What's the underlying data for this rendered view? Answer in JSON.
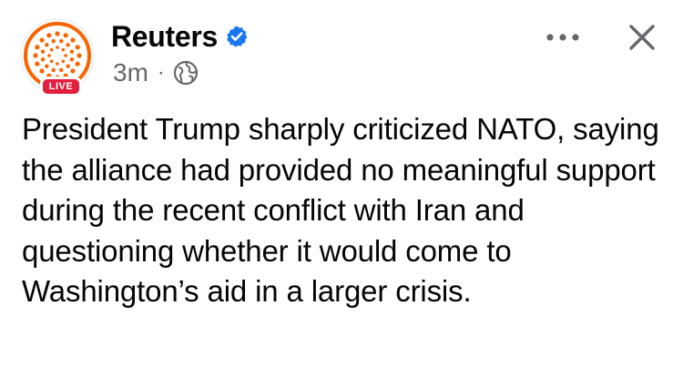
{
  "post": {
    "author": "Reuters",
    "verified": true,
    "live_badge": "LIVE",
    "timestamp": "3m",
    "separator": "·",
    "audience_icon": "globe-icon",
    "more_icon": "more-options-icon",
    "close_icon": "close-icon",
    "text": "President Trump sharply criticized NATO, saying the alliance had provided no meaningful support during the recent conflict with Iran and questioning whether it would come to Washington’s aid in a larger crisis."
  },
  "colors": {
    "brand_orange": "#fa6400",
    "live_red": "#e41e3f",
    "verified_blue": "#1877f2",
    "meta_gray": "#65676b",
    "text": "#050505"
  }
}
